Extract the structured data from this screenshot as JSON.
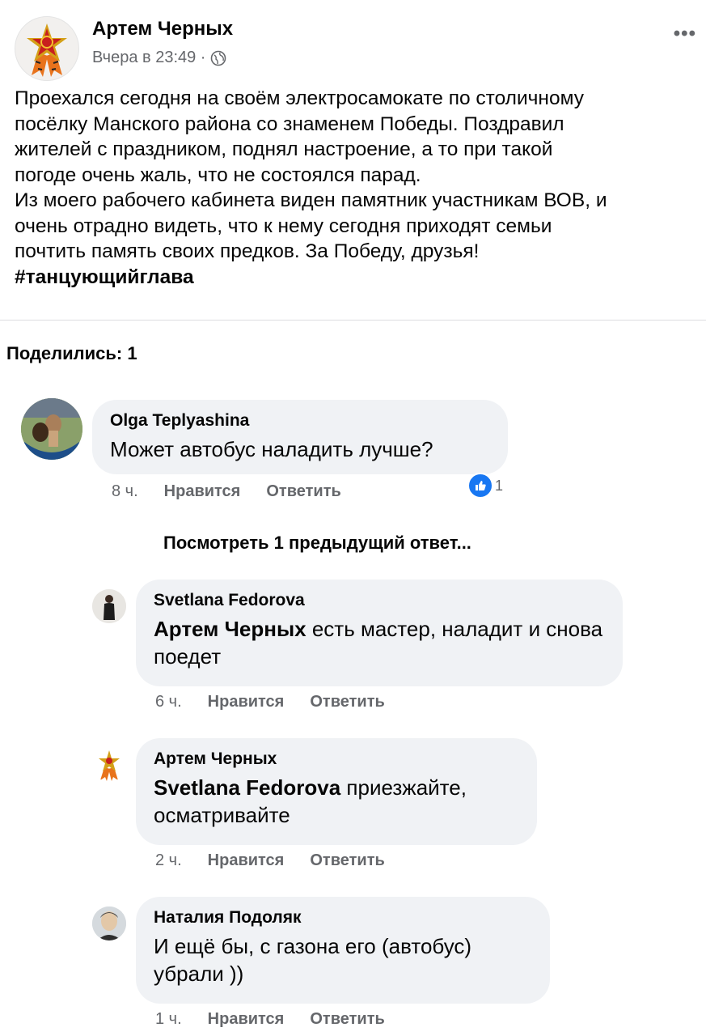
{
  "post": {
    "author": "Артем Черных",
    "time": "Вчера в 23:49 ·",
    "more": "•••",
    "text_lines": [
      "Проехался сегодня на своём электросамокате по столичному",
      "посёлку Манского района со знаменем Победы. Поздравил",
      "жителей с праздником, поднял настроение, а то при такой",
      "погоде очень жаль, что не состоялся парад.",
      "Из моего рабочего кабинета виден памятник участникам ВОВ, и",
      "очень отрадно видеть, что к нему сегодня приходят семьи",
      "почтить память своих предков. За Победу, друзья!"
    ],
    "hashtag": "#танцующийглава"
  },
  "shares": "Поделились: 1",
  "view_previous": "Посмотреть 1 предыдущий ответ...",
  "comments": [
    {
      "name": "Olga  Teplyashina",
      "mention": "",
      "text": "Может автобус наладить лучше?",
      "time": "8 ч.",
      "like": "Нравится",
      "reply": "Ответить",
      "reactions": "1"
    },
    {
      "name": "Svetlana Fedorova",
      "mention": "Артем Черных",
      "text": " есть мастер, наладит и снова поедет",
      "time": "6 ч.",
      "like": "Нравится",
      "reply": "Ответить"
    },
    {
      "name": "Артем Черных",
      "mention": "Svetlana Fedorova",
      "text": " приезжайте, осматривайте",
      "time": "2 ч.",
      "like": "Нравится",
      "reply": "Ответить"
    },
    {
      "name": "Наталия Подоляк",
      "mention": "",
      "text": "И ещё бы, с газона его (автобус) убрали ))",
      "time": "1 ч.",
      "like": "Нравится",
      "reply": "Ответить"
    }
  ],
  "colors": {
    "bubble": "#f0f2f5",
    "secondary_text": "#65676b",
    "like_blue": "#1877f2",
    "ribbon_orange": "#e8731c",
    "star_red": "#c8201e"
  }
}
